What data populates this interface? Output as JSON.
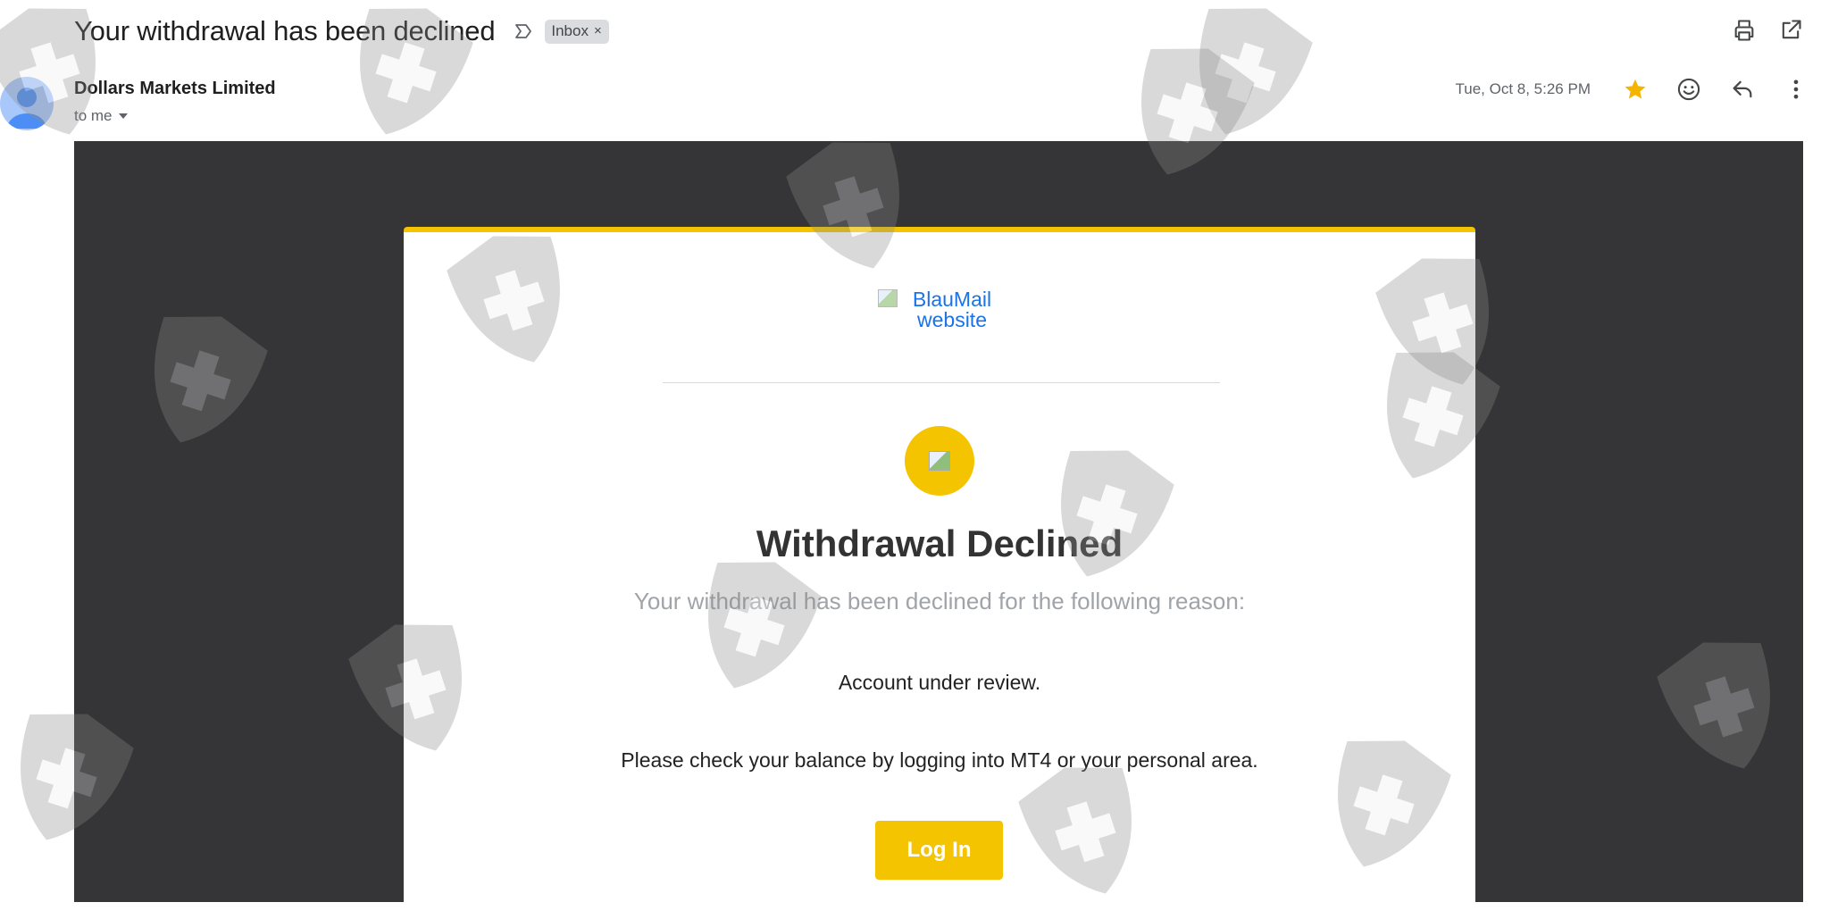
{
  "subject": "Your withdrawal has been declined",
  "label_chip": "Inbox",
  "label_remove": "×",
  "sender": "Dollars Markets Limited",
  "recipient": "to me",
  "date": "Tue, Oct 8, 5:26 PM",
  "email": {
    "logo_alt": "BlauMail website",
    "heading": "Withdrawal Declined",
    "reason_intro": "Your withdrawal has been declined for the following reason:",
    "reason": "Account under review.",
    "instruction": "Please check your balance by logging into MT4 or your personal area.",
    "login_button": "Log In"
  },
  "icons": {
    "importance": "importance-marker-icon",
    "print": "print-icon",
    "popout": "open-in-new-window-icon",
    "star": "star-icon",
    "emoji": "emoji-reaction-icon",
    "reply": "reply-icon",
    "more": "more-vert-icon",
    "recipient_dropdown": "caret-down-icon"
  },
  "colors": {
    "accent_yellow": "#f5c400",
    "email_background": "#353537",
    "link_blue": "#1a73e8",
    "star": "#f4b400"
  }
}
